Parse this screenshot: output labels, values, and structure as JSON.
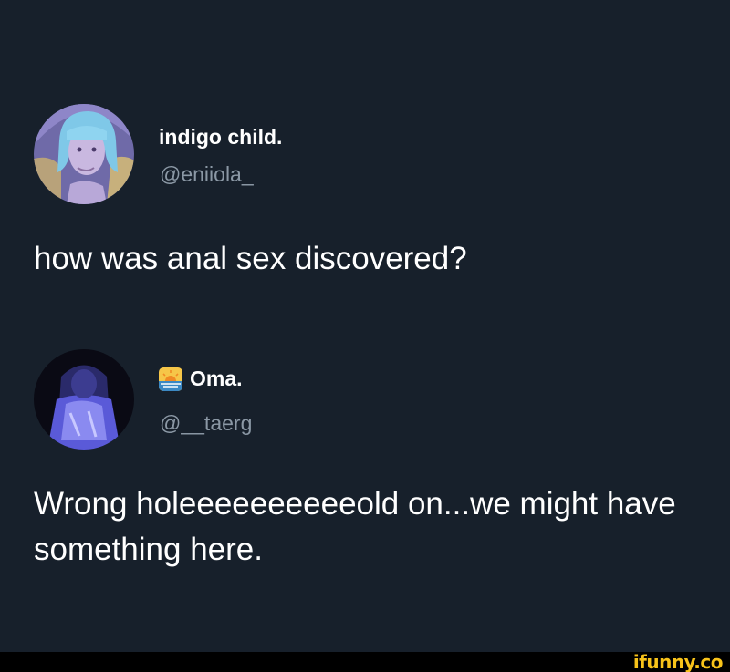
{
  "tweets": [
    {
      "display_name": "indigo child.",
      "handle": "@eniiola_",
      "text": "how was anal sex discovered?",
      "avatar_icon": "illustrated-blue-hair-woman-avatar"
    },
    {
      "display_name": "Oma.",
      "name_emoji": "sunrise-emoji",
      "handle": "@__taerg",
      "text": "Wrong holeeeeeeeeeeold on...we might have something here.",
      "avatar_icon": "blue-tinted-person-photo-avatar"
    }
  ],
  "footer": {
    "watermark": "ifunny.co"
  },
  "colors": {
    "background": "#17202b",
    "text": "#ffffff",
    "handle": "#8b98a5",
    "watermark": "#f8c31a"
  }
}
